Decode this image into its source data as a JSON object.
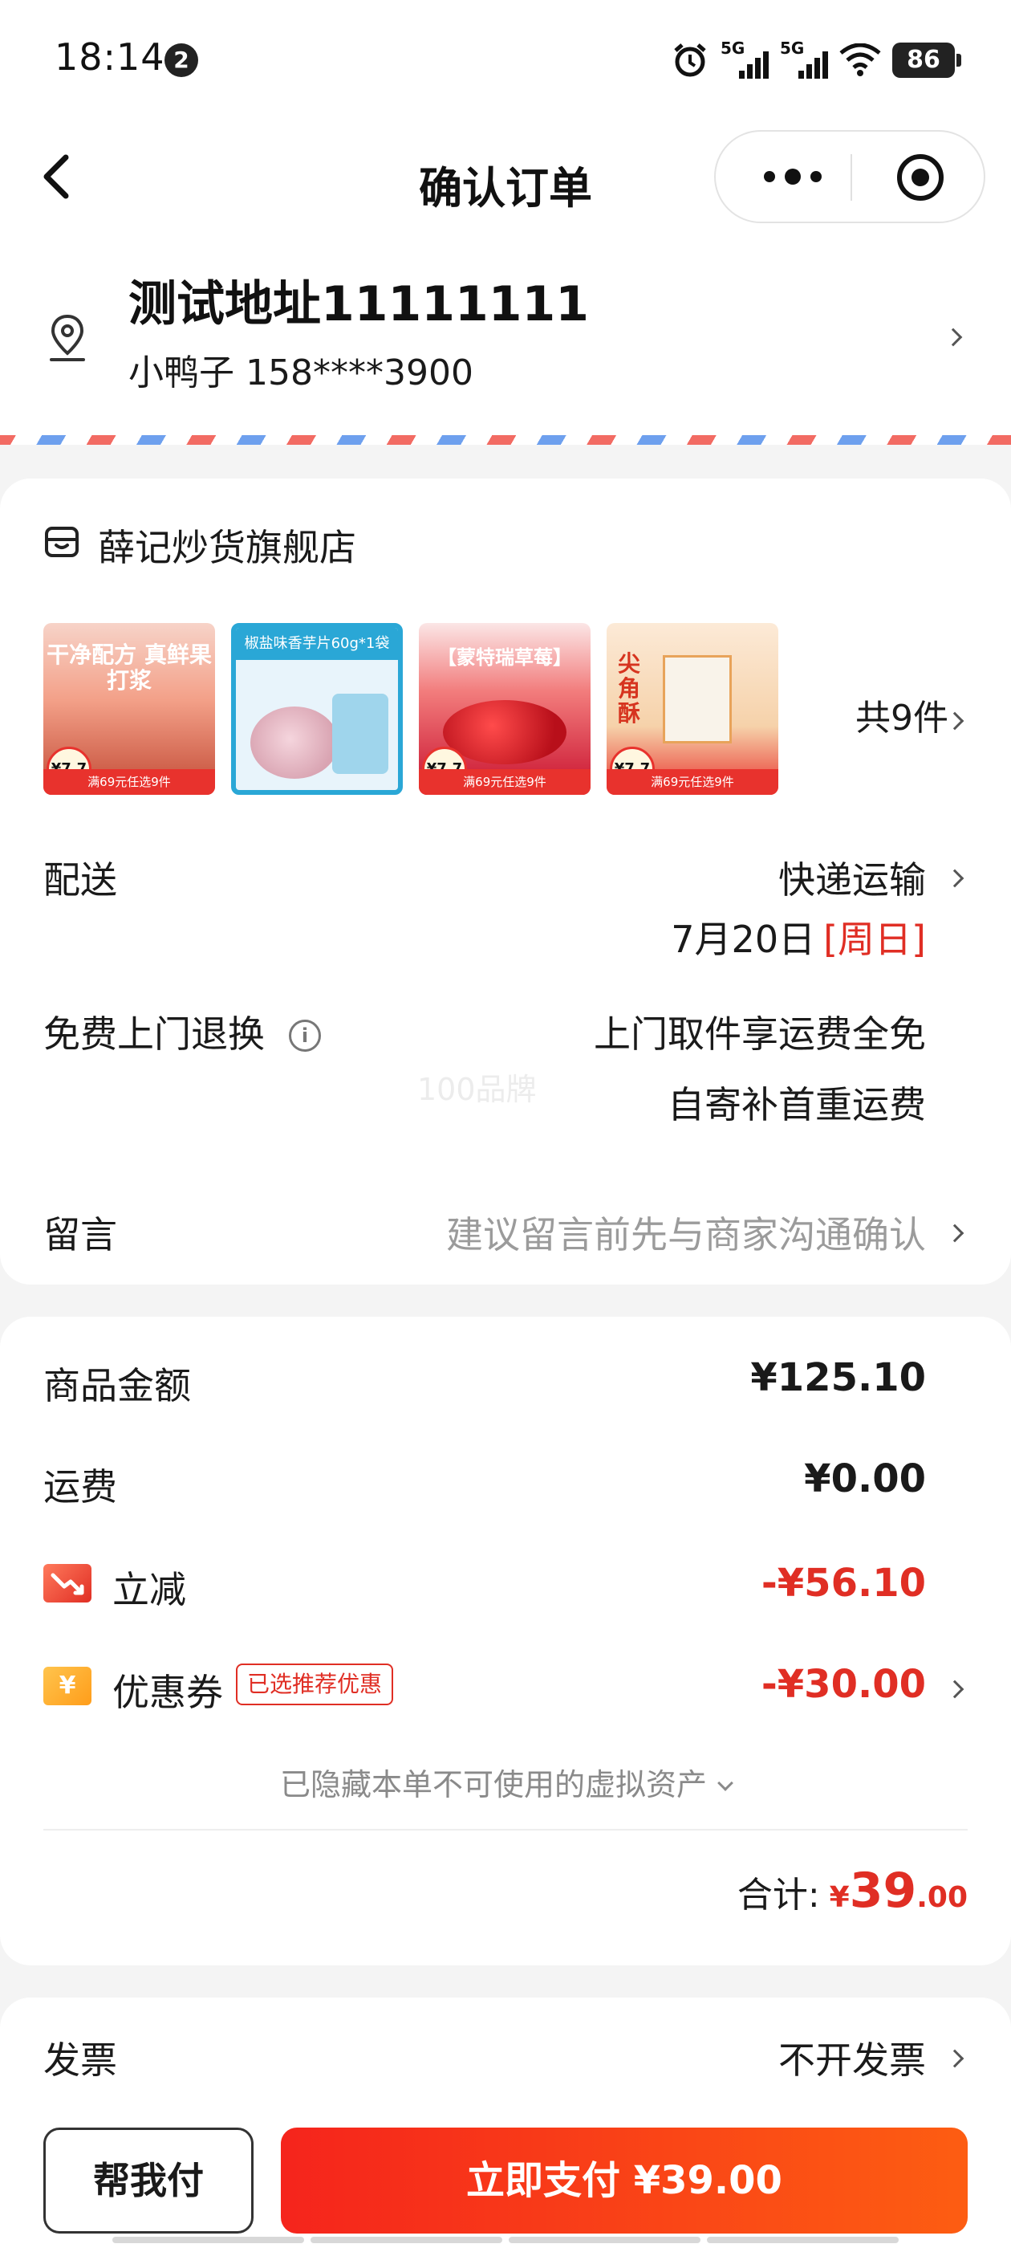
{
  "status_bar": {
    "time": "18:14",
    "notification_count": "2",
    "net1": "5G",
    "net2": "5G",
    "battery": "86"
  },
  "nav": {
    "title": "确认订单"
  },
  "address": {
    "line1": "测试地址11111111",
    "contact": "小鸭子 158****3900"
  },
  "shop": {
    "name": "薛记炒货旗舰店",
    "thumbs": [
      {
        "headline": "干净配方 真鲜果打浆",
        "strip": "满69元任选9件",
        "price": "¥7.7"
      },
      {
        "headline": "椒盐味香芋片60g*1袋",
        "strip": "",
        "price": ""
      },
      {
        "headline": "【蒙特瑞草莓】",
        "strip": "满69元任选9件",
        "price": "¥7.7"
      },
      {
        "headline": "尖角酥",
        "strip": "满69元任选9件",
        "price": "¥7.7"
      }
    ],
    "item_count": "共9件"
  },
  "delivery": {
    "label": "配送",
    "method": "快递运输",
    "date": "7月20日",
    "weekday": "[周日]"
  },
  "returns": {
    "label": "免费上门退换",
    "line1": "上门取件享运费全免",
    "line2": "自寄补首重运费",
    "watermark": "100品牌"
  },
  "message": {
    "label": "留言",
    "placeholder": "建议留言前先与商家沟通确认"
  },
  "pricing": {
    "goods_label": "商品金额",
    "goods_value": "¥125.10",
    "shipping_label": "运费",
    "shipping_value": "¥0.00",
    "discount_label": "立减",
    "discount_value": "-¥56.10",
    "coupon_label": "优惠券",
    "coupon_tag": "已选推荐优惠",
    "coupon_value": "-¥30.00",
    "hidden_assets": "已隐藏本单不可使用的虚拟资产",
    "total_label": "合计:",
    "total_currency": "¥",
    "total_int": "39",
    "total_dec": ".00"
  },
  "invoice": {
    "label": "发票",
    "value": "不开发票"
  },
  "bottom": {
    "help_pay": "帮我付",
    "pay_now": "立即支付 ¥39.00"
  },
  "colors": {
    "accent": "#e02e24",
    "pay_button": "#fb4d15"
  }
}
